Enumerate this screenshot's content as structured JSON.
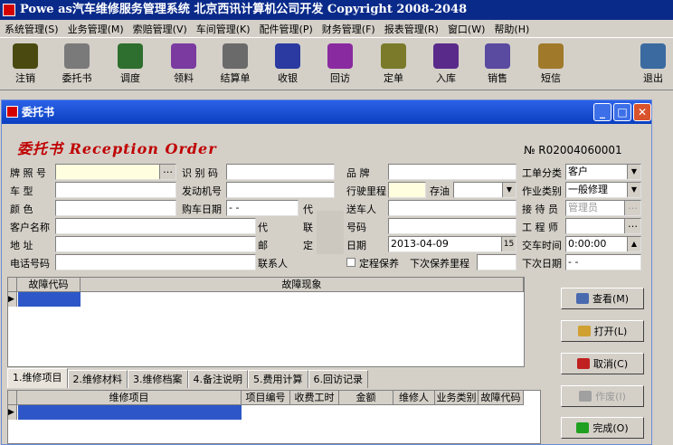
{
  "app": {
    "title": "Powe  as汽车维修服务管理系统 北京西讯计算机公司开发 Copyright 2008-2048"
  },
  "menu": [
    "系统管理(S)",
    "业务管理(M)",
    "索赔管理(V)",
    "车间管理(K)",
    "配件管理(P)",
    "财务管理(F)",
    "报表管理(R)",
    "窗口(W)",
    "帮助(H)"
  ],
  "toolbar": [
    {
      "label": "注销",
      "icon": "car-key-icon",
      "color": "#4a4a10"
    },
    {
      "label": "委托书",
      "icon": "document-pen-icon",
      "color": "#7a7a7a"
    },
    {
      "label": "调度",
      "icon": "schedule-icon",
      "color": "#2e6e2e"
    },
    {
      "label": "领料",
      "icon": "material-icon",
      "color": "#7a3aa0"
    },
    {
      "label": "结算单",
      "icon": "settlement-icon",
      "color": "#6a6a6a"
    },
    {
      "label": "收银",
      "icon": "cash-register-icon",
      "color": "#2a3aa0"
    },
    {
      "label": "回访",
      "icon": "phone-icon",
      "color": "#8a2aa0"
    },
    {
      "label": "定单",
      "icon": "order-icon",
      "color": "#7a7a2a"
    },
    {
      "label": "入库",
      "icon": "warehouse-in-icon",
      "color": "#5a2a8a"
    },
    {
      "label": "销售",
      "icon": "sales-icon",
      "color": "#5a4aa0"
    },
    {
      "label": "短信",
      "icon": "sms-icon",
      "color": "#a07a2a"
    },
    {
      "label": "退出",
      "icon": "exit-icon",
      "color": "#3a6aa0"
    }
  ],
  "window": {
    "title": "委托书"
  },
  "form": {
    "heading": "委托书 Reception Order",
    "order_no": "№ R02004060001",
    "labels": {
      "plate": "牌 照 号",
      "vehicle_type": "车    型",
      "color": "颜    色",
      "customer": "客户名称",
      "address": "地    址",
      "phone": "电话号码",
      "vin": "识 别 码",
      "engine": "发动机号",
      "purchase_date": "购车日期",
      "brand": "品    牌",
      "mileage": "行驶里程",
      "fuel": "存油",
      "sender": "送车人",
      "phone2": "号码",
      "date": "日期",
      "order_type": "工单分类",
      "work_type": "作业类别",
      "receptionist": "接 待 员",
      "engineer": "工 程 师",
      "delivery_time": "交车时间",
      "next_date": "下次日期",
      "maintenance": "定程保养",
      "next_mileage": "下次保养里程",
      "agent": "代",
      "contact": "联",
      "post": "邮",
      "fixed": "定",
      "contact_person": "联系人",
      "agent2": "代"
    },
    "values": {
      "purchase_date": "  -  -  ",
      "date": "2013-04-09",
      "order_type": "客户",
      "work_type": "一般修理",
      "receptionist": "管理员",
      "delivery_time": "0:00:00",
      "next_date": "  -  -  "
    }
  },
  "fault_grid": {
    "headers": [
      "故障代码",
      "故障现象"
    ]
  },
  "tabs": [
    "1.维修项目",
    "2.维修材料",
    "3.维修档案",
    "4.备注说明",
    "5.费用计算",
    "6.回访记录"
  ],
  "repair_grid": {
    "headers": [
      "维修项目",
      "项目编号",
      "收费工时",
      "金额",
      "维修人",
      "业务类别",
      "故障代码"
    ]
  },
  "buttons": {
    "view": "查看(M)",
    "open": "打开(L)",
    "cancel": "取消(C)",
    "void": "作废(I)",
    "done": "完成(O)"
  }
}
